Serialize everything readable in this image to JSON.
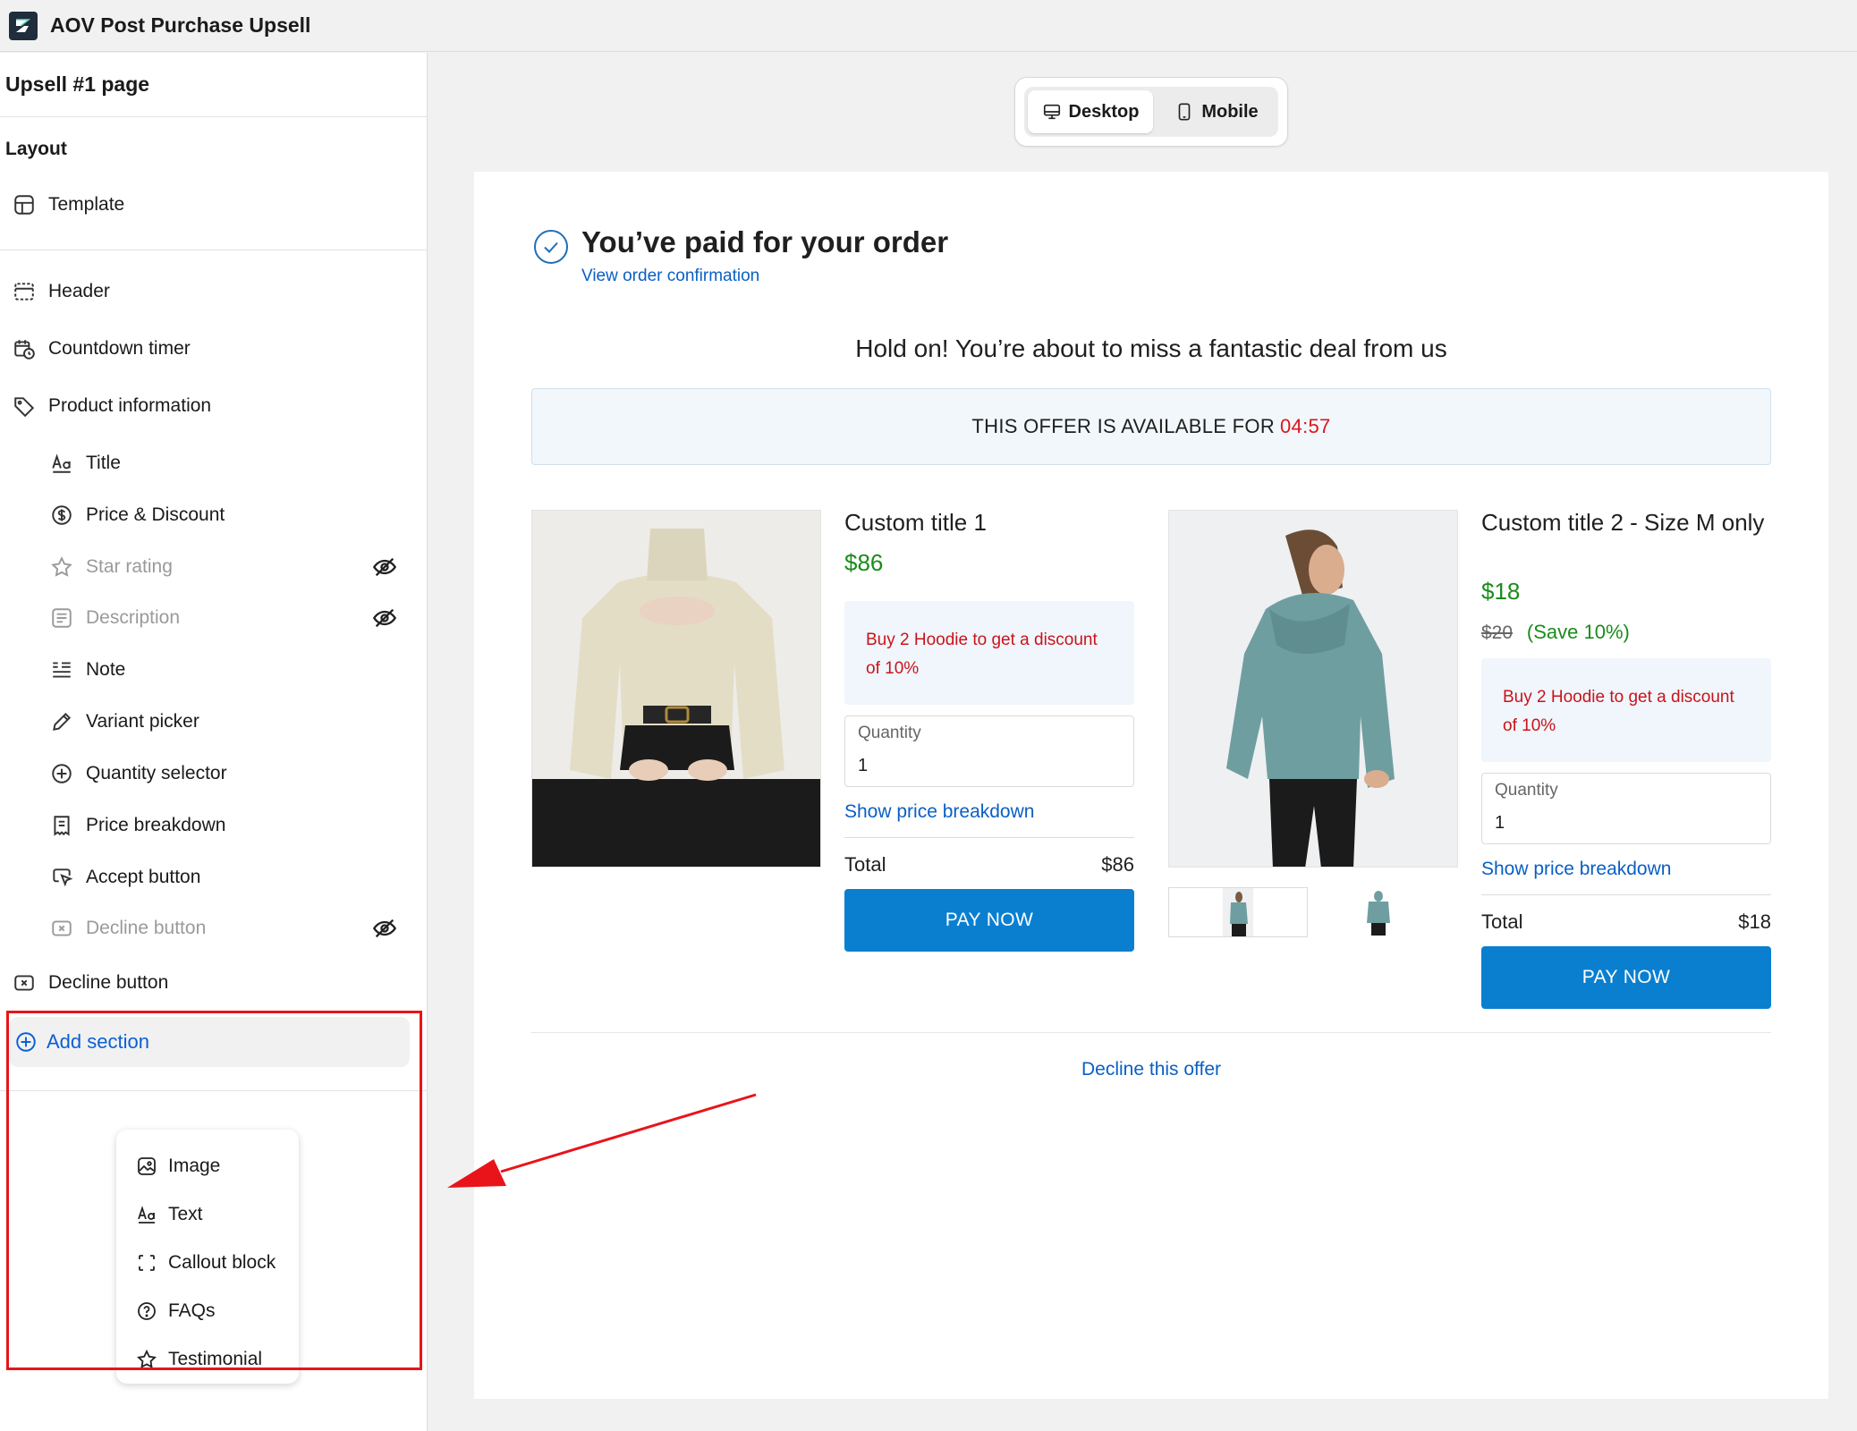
{
  "app": {
    "title": "AOV Post Purchase Upsell"
  },
  "sidebar": {
    "title": "Upsell #1 page",
    "layout_label": "Layout",
    "template_label": "Template",
    "items": [
      {
        "label": "Header",
        "icon": "header-icon"
      },
      {
        "label": "Countdown timer",
        "icon": "timer-icon"
      },
      {
        "label": "Product information",
        "icon": "tag-icon"
      }
    ],
    "sub_items": [
      {
        "label": "Title",
        "icon": "text-icon",
        "hidden": false
      },
      {
        "label": "Price & Discount",
        "icon": "dollar-icon",
        "hidden": false
      },
      {
        "label": "Star rating",
        "icon": "star-icon",
        "hidden": true
      },
      {
        "label": "Description",
        "icon": "description-icon",
        "hidden": true
      },
      {
        "label": "Note",
        "icon": "note-icon",
        "hidden": false
      },
      {
        "label": "Variant picker",
        "icon": "pencil-icon",
        "hidden": false
      },
      {
        "label": "Quantity selector",
        "icon": "plus-circle-icon",
        "hidden": false
      },
      {
        "label": "Price breakdown",
        "icon": "receipt-icon",
        "hidden": false
      },
      {
        "label": "Accept button",
        "icon": "cursor-icon",
        "hidden": false
      },
      {
        "label": "Decline button",
        "icon": "x-square-icon",
        "hidden": true
      }
    ],
    "decline_label": "Decline button",
    "add_section_label": "Add section",
    "add_menu": [
      {
        "label": "Image",
        "icon": "image-icon"
      },
      {
        "label": "Text",
        "icon": "text-icon"
      },
      {
        "label": "Callout block",
        "icon": "callout-icon"
      },
      {
        "label": "FAQs",
        "icon": "question-icon"
      },
      {
        "label": "Testimonial",
        "icon": "star-icon"
      }
    ]
  },
  "device_toggle": {
    "desktop": "Desktop",
    "mobile": "Mobile",
    "selected": "Desktop"
  },
  "preview": {
    "paid_title": "You’ve paid for your order",
    "view_link": "View order confirmation",
    "hold_on": "Hold on! You’re about to miss a fantastic deal from us",
    "timer_text": "THIS OFFER IS AVAILABLE FOR",
    "timer_value": "04:57",
    "products": [
      {
        "title": "Custom title 1",
        "price": "$86",
        "note": "Buy 2 Hoodie to get a discount of 10%",
        "quantity_label": "Quantity",
        "quantity": "1",
        "breakdown": "Show price breakdown",
        "total_label": "Total",
        "total": "$86",
        "pay": "PAY NOW"
      },
      {
        "title": "Custom title 2 - Size M only",
        "price": "$18",
        "compare_price": "$20",
        "save": "(Save 10%)",
        "note": "Buy 2 Hoodie to get a discount of 10%",
        "quantity_label": "Quantity",
        "quantity": "1",
        "breakdown": "Show price breakdown",
        "total_label": "Total",
        "total": "$18",
        "pay": "PAY NOW"
      }
    ],
    "decline": "Decline this offer"
  },
  "colors": {
    "accent": "#0a7fd0",
    "link": "#0a5fc4",
    "price_green": "#1a8c1a",
    "alert_red": "#d9161c",
    "annotation_red": "#e8141a"
  }
}
